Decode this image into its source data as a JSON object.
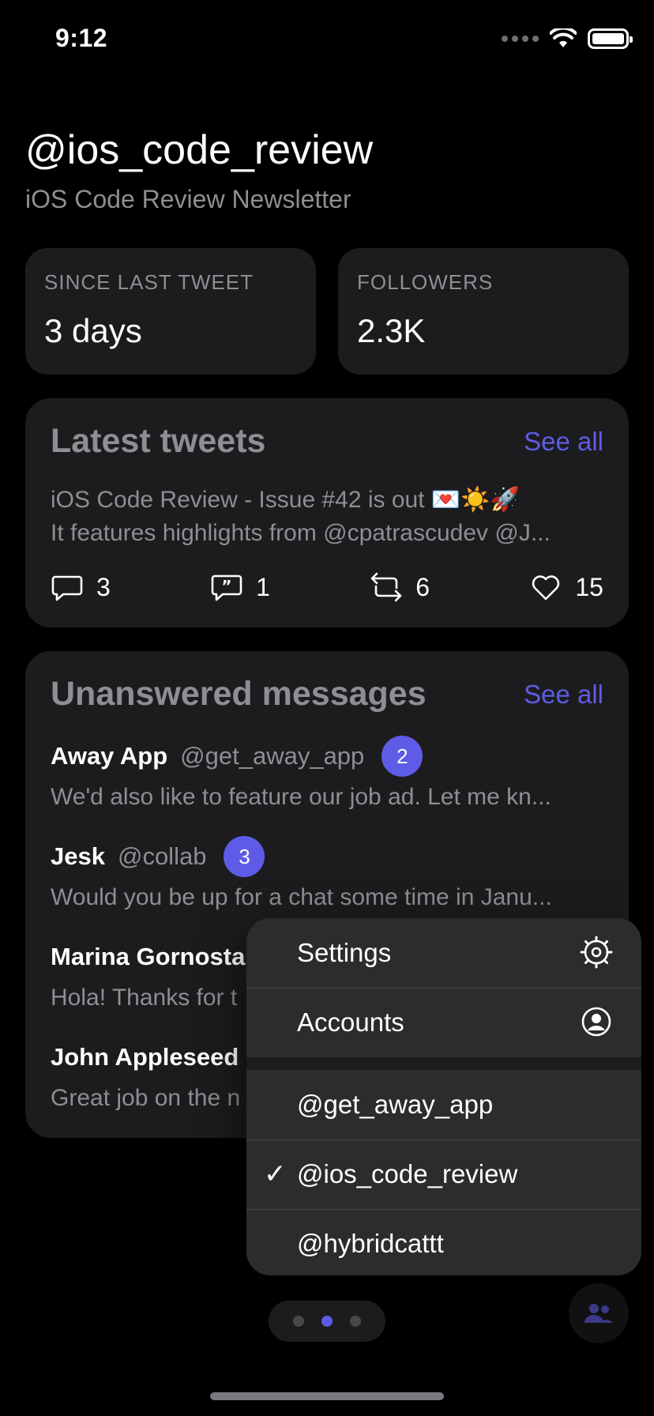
{
  "status_bar": {
    "time": "9:12"
  },
  "header": {
    "title": "@ios_code_review",
    "subtitle": "iOS Code Review Newsletter"
  },
  "stats": [
    {
      "label": "SINCE LAST TWEET",
      "value": "3 days"
    },
    {
      "label": "FOLLOWERS",
      "value": "2.3K"
    }
  ],
  "tweets": {
    "title": "Latest tweets",
    "see_all": "See all",
    "line1": "iOS Code Review - Issue #42 is out 💌☀️🚀",
    "line2": "It features highlights from @cpatrascudev @J...",
    "replies": "3",
    "quotes": "1",
    "retweets": "6",
    "likes": "15"
  },
  "messages": {
    "title": "Unanswered messages",
    "see_all": "See all",
    "items": [
      {
        "name": "Away App",
        "handle": "@get_away_app",
        "badge": "2",
        "body": "We'd also like to feature our job ad. Let me kn..."
      },
      {
        "name": "Jesk",
        "handle": "@collab",
        "badge": "3",
        "body": "Would you be up for a chat some time in Janu..."
      },
      {
        "name": "Marina Gornosta",
        "handle": "",
        "badge": "",
        "body": "Hola! Thanks for t"
      },
      {
        "name": "John Appleseed",
        "handle": "",
        "badge": "",
        "body": "Great job on the n"
      }
    ]
  },
  "menu": {
    "settings": "Settings",
    "accounts": "Accounts",
    "account_items": [
      {
        "label": "@get_away_app",
        "checked": false
      },
      {
        "label": "@ios_code_review",
        "checked": true
      },
      {
        "label": "@hybridcattt",
        "checked": false
      }
    ],
    "check_glyph": "✓"
  },
  "colors": {
    "accent": "#5e5ce6",
    "card": "#1c1c1e",
    "secondary_text": "#8e8e93"
  },
  "pager": {
    "pages": 3,
    "current": 2
  }
}
